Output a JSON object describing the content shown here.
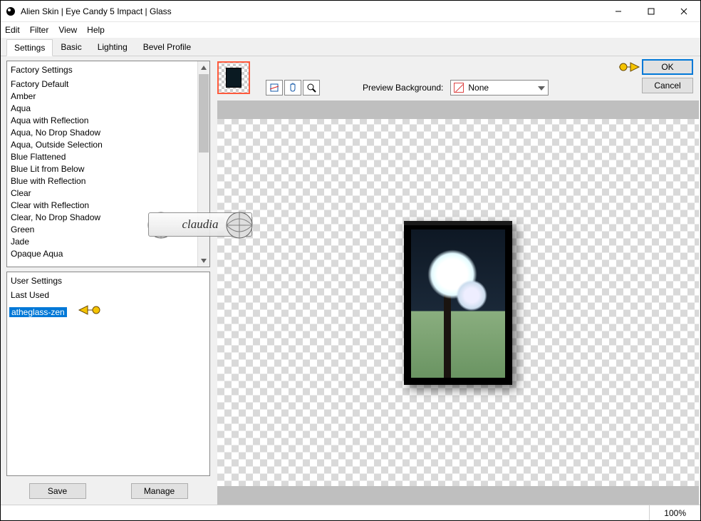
{
  "window": {
    "title": "Alien Skin | Eye Candy 5 Impact | Glass",
    "menu": [
      "Edit",
      "Filter",
      "View",
      "Help"
    ],
    "tabs": [
      "Settings",
      "Basic",
      "Lighting",
      "Bevel Profile"
    ],
    "active_tab": 0,
    "win_controls": {
      "min": "minimize",
      "max": "maximize",
      "close": "close"
    }
  },
  "factory": {
    "header": "Factory Settings",
    "items": [
      "Factory Default",
      "Amber",
      "Aqua",
      "Aqua with Reflection",
      "Aqua, No Drop Shadow",
      "Aqua, Outside Selection",
      "Blue Flattened",
      "Blue Lit from Below",
      "Blue with Reflection",
      "Clear",
      "Clear with Reflection",
      "Clear, No Drop Shadow",
      "Green",
      "Jade",
      "Opaque Aqua"
    ]
  },
  "user": {
    "header": "User Settings",
    "items": [
      "Last Used",
      "atheglass-zen"
    ],
    "selected_index": 1
  },
  "buttons": {
    "save": "Save",
    "manage": "Manage",
    "ok": "OK",
    "cancel": "Cancel"
  },
  "preview": {
    "label": "Preview Background:",
    "value": "None",
    "tools": [
      "crop-tool",
      "hand-tool",
      "zoom-tool"
    ]
  },
  "status": {
    "zoom": "100%"
  },
  "watermark": "claudia"
}
